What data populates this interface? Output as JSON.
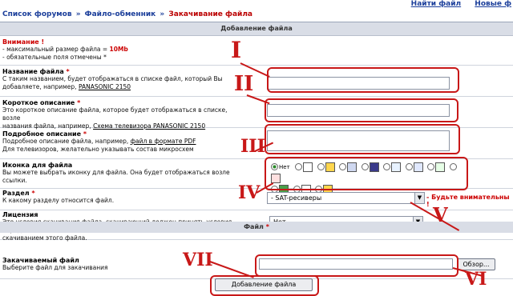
{
  "breadcrumb": {
    "forum_list": "Список форумов",
    "sep1": "»",
    "file_exchange": "Файло-обменник",
    "sep2": "»",
    "current": "Закачивание файла"
  },
  "top_links": [
    "Найти файл",
    "Новые ф"
  ],
  "section_title": "Добавление файла",
  "notice": {
    "title": "Внимание !",
    "max_size_prefix": "- максимальный размер файла = ",
    "max_size_value": "10Mb",
    "required_note": "- обязательные поля отмечены *"
  },
  "fields": {
    "name": {
      "label": "Название файла",
      "required": "*",
      "desc1": "С таким названием, будет отображаться в списке файл, который Вы",
      "desc2_prefix": "добавляете, например, ",
      "desc2_example": "PANASONIC 2150"
    },
    "short": {
      "label": "Короткое описание",
      "required": "*",
      "desc1": "Это короткое описание файла, которое будет отображаться в списке, возле",
      "desc2_prefix": "названия файла, например, ",
      "desc2_example": "Схема телевизора PANASONIC 2150"
    },
    "full": {
      "label": "Подробное описание",
      "required": "*",
      "desc1_prefix": "Подробное описание файла, например, ",
      "desc1_example": "файл в формате PDF",
      "desc2": "Для телевизоров, желательно указывать состав микросхем"
    },
    "icon": {
      "label": "Иконка для файла",
      "desc1": "Вы можете выбрать иконку для файла. Она будет отображаться возле",
      "desc2": "ссылки.",
      "none_label": "Нет"
    },
    "section": {
      "label": "Раздел",
      "required": "*",
      "desc": "К какому разделу относится файл.",
      "selected": "- SAT-ресиверы",
      "warning": "- Будьте внимательны !"
    },
    "license": {
      "label": "Лицензия",
      "desc1": "Это условия скачивания файла, скачивающий должен принять условия перед",
      "desc2": "скачиванием этого файла.",
      "selected": "Нет"
    }
  },
  "file_section": {
    "title": "Файл",
    "required": "*",
    "label": "Закачиваемый файл",
    "desc": "Выберите файл для закачивания",
    "browse": "Обзор..."
  },
  "submit_label": "Добавление файла",
  "annotations": [
    "I",
    "II",
    "III",
    "IV",
    "V",
    "VI",
    "VII"
  ],
  "colors": {
    "annotation": "#c81818",
    "link": "#1c3f9b",
    "header_bg": "#d9dde6"
  }
}
